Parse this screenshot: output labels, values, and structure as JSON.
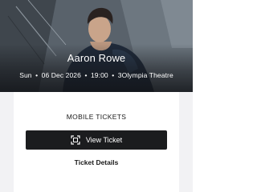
{
  "event": {
    "artist": "Aaron Rowe",
    "day": "Sun",
    "date": "06 Dec 2026",
    "time": "19:00",
    "venue": "3Olympia Theatre",
    "separator": "•"
  },
  "tickets": {
    "section_title": "MOBILE TICKETS",
    "view_button_label": "View Ticket",
    "view_button_icon": "ticket-scan-icon",
    "details_link": "Ticket Details"
  },
  "colors": {
    "button_bg": "#1b1c1e",
    "page_bg": "#f2f2f4",
    "card_bg": "#ffffff"
  }
}
